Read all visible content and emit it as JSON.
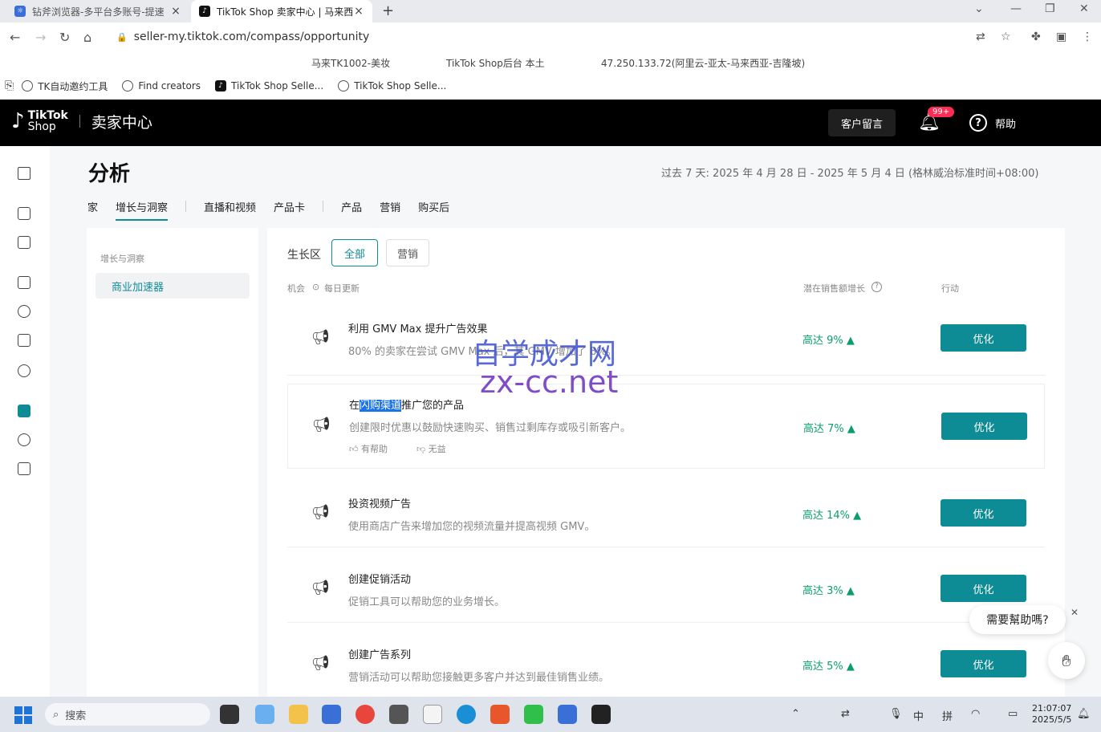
{
  "browser": {
    "tabs": [
      {
        "title": "钻斧浏览器-多平台多账号-提速",
        "active": false
      },
      {
        "title": "TikTok Shop 卖家中心 | 马来西",
        "active": true
      }
    ],
    "url": "seller-my.tiktok.com/compass/opportunity",
    "info": [
      "马来TK1002-美妆",
      "TikTok Shop后台 本土",
      "47.250.133.72(阿里云-亚太-马来西亚-吉隆坡)"
    ],
    "bookmarks": [
      "TK自动邀约工具",
      "Find creators",
      "TikTok Shop Selle...",
      "TikTok Shop Selle..."
    ]
  },
  "header": {
    "brand_line1": "TikTok",
    "brand_line2": "Shop",
    "seller_center": "卖家中心",
    "customer_msg": "客户留言",
    "notif_badge": "99+",
    "help": "帮助"
  },
  "page": {
    "title": "分析",
    "date_range": "过去 7 天:  2025 年 4 月 28 日 - 2025 年 5 月 4 日    (格林威治标准时间+08:00)",
    "nav_tabs": [
      "家",
      "增长与洞察",
      "直播和视频",
      "产品卡",
      "产品",
      "营销",
      "购买后"
    ],
    "left_title": "增长与洞察",
    "left_item": "商业加速器",
    "segment_label": "生长区",
    "segments": [
      "全部",
      "营销"
    ],
    "col_opportunity": "机会",
    "col_daily": "每日更新",
    "col_growth": "潜在销售额增长",
    "col_action": "行动"
  },
  "opportunities": [
    {
      "title": "利用 GMV Max 提升广告效果",
      "desc": "80% 的卖家在尝试 GMV Max 后，其 GMV 增加了 8%。",
      "growth": "高达 9%",
      "action": "优化"
    },
    {
      "title_pre": "在",
      "title_hl": "闪购渠道",
      "title_post": "推广您的产品",
      "desc": "创建限时优惠以鼓励快速购买、销售过剩库存或吸引新客户。",
      "growth": "高达 7%",
      "action": "优化",
      "helpful": "有帮助",
      "unhelpful": "无益"
    },
    {
      "title": "投资视频广告",
      "desc": "使用商店广告来增加您的视频流量并提高视频 GMV。",
      "growth": "高达 14%",
      "action": "优化"
    },
    {
      "title": "创建促销活动",
      "desc": "促销工具可以帮助您的业务增长。",
      "growth": "高达 3%",
      "action": "优化"
    },
    {
      "title": "创建广告系列",
      "desc": "营销活动可以帮助您接触更多客户并达到最佳销售业绩。",
      "growth": "高达 5%",
      "action": "优化"
    }
  ],
  "chat": {
    "prompt": "需要幫助嗎?"
  },
  "watermark": {
    "line1": "自学成才网",
    "line2": "zx-cc.net"
  },
  "taskbar": {
    "search": "搜索",
    "ime1": "中",
    "ime2": "拼",
    "time": "21:07:07",
    "date": "2025/5/5"
  }
}
